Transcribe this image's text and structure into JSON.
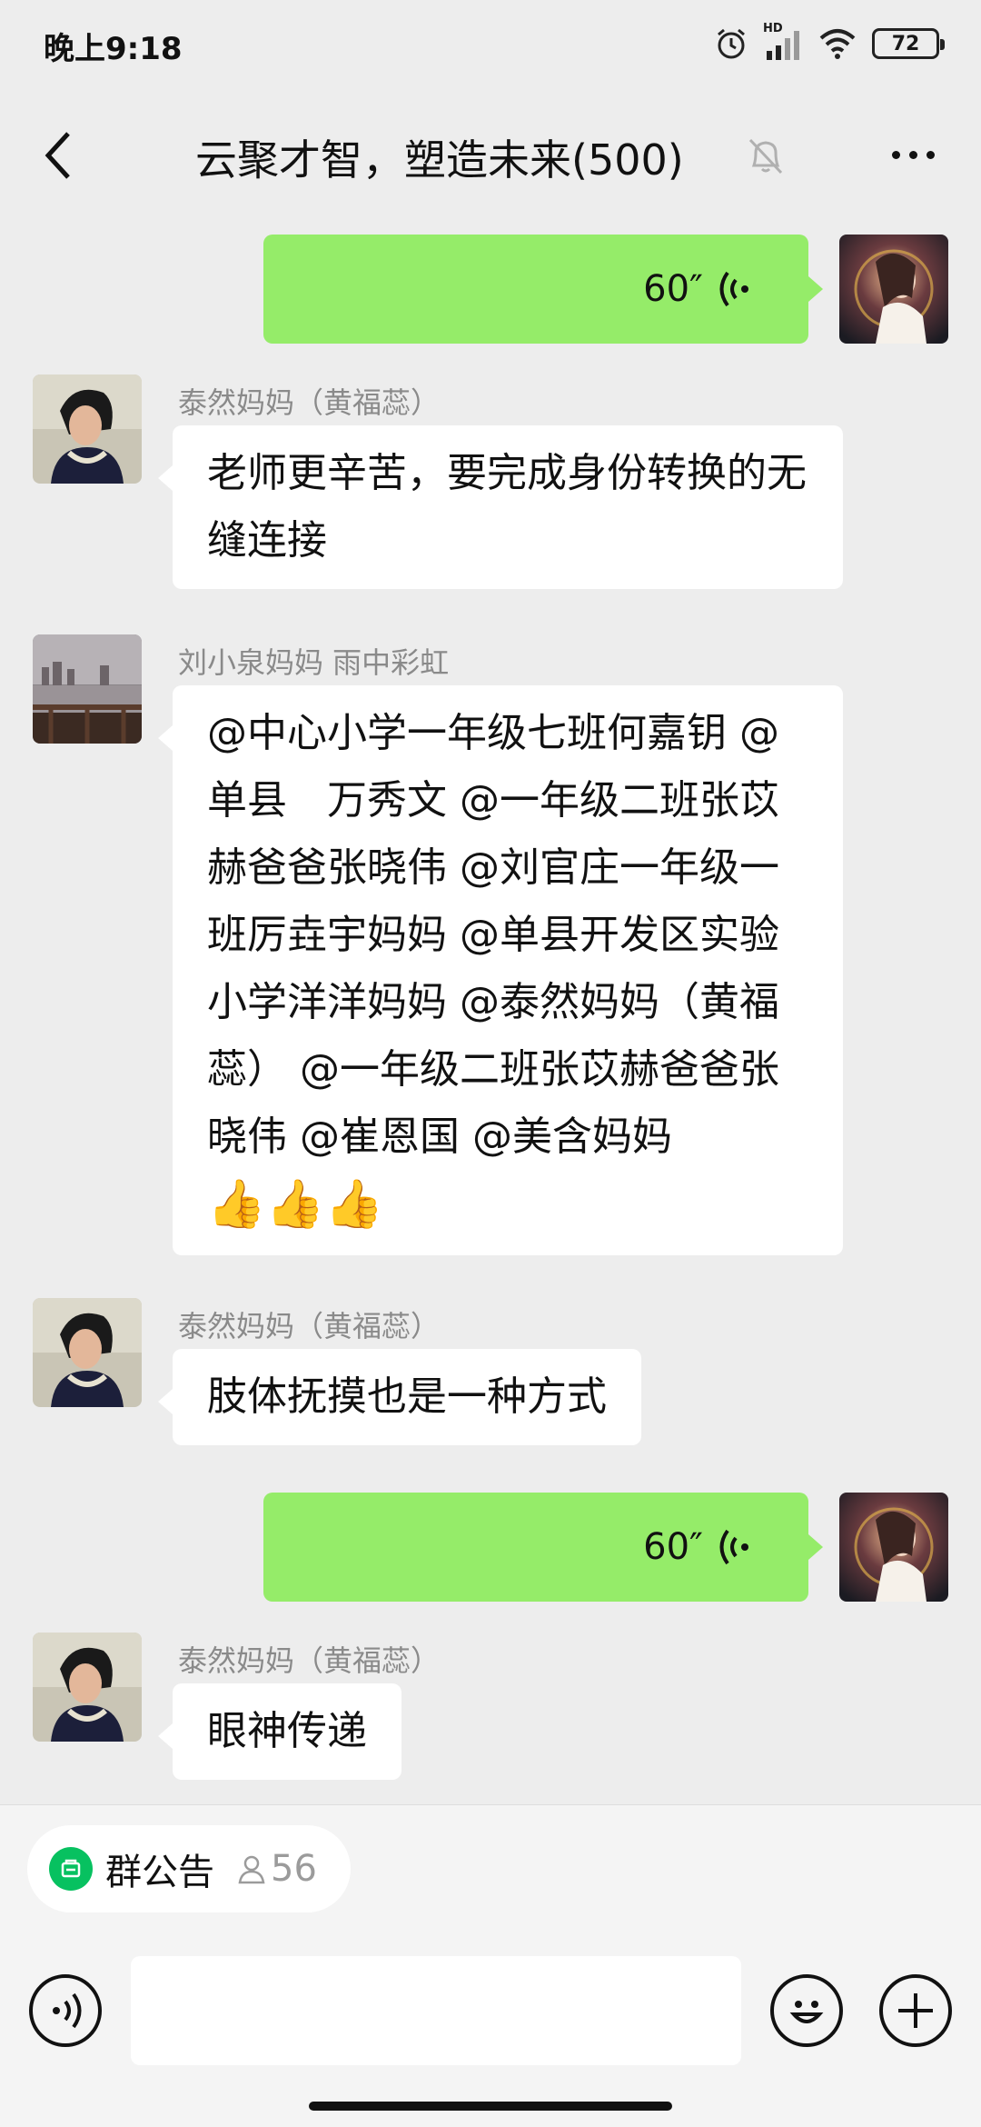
{
  "status_bar": {
    "time": "晚上9:18",
    "network_label": "HD",
    "battery": "72"
  },
  "header": {
    "title": "云聚才智，塑造未来(500)"
  },
  "messages": [
    {
      "type": "voice",
      "direction": "out",
      "duration": "60″"
    },
    {
      "type": "text",
      "direction": "in",
      "sender": "泰然妈妈（黄福蕊）",
      "text": "老师更辛苦，要完成身份转换的无缝连接"
    },
    {
      "type": "text",
      "direction": "in",
      "sender": "刘小泉妈妈  雨中彩虹",
      "text": "@中心小学一年级七班何嘉钥 @单县　万秀文 @一年级二班张苡赫爸爸张晓伟 @刘官庄一年级一班厉垚宇妈妈 @单县开发区实验小学洋洋妈妈 @泰然妈妈（黄福蕊） @一年级二班张苡赫爸爸张晓伟 @崔恩国 @美含妈妈",
      "emoji": "👍👍👍"
    },
    {
      "type": "text",
      "direction": "in",
      "sender": "泰然妈妈（黄福蕊）",
      "text": "肢体抚摸也是一种方式"
    },
    {
      "type": "voice",
      "direction": "out",
      "duration": "60″"
    },
    {
      "type": "text",
      "direction": "in",
      "sender": "泰然妈妈（黄福蕊）",
      "text": "眼神传递"
    }
  ],
  "notice": {
    "label": "群公告",
    "count": "56"
  },
  "colors": {
    "background": "#ededed",
    "out_bubble": "#95ec69",
    "in_bubble": "#ffffff",
    "notice_icon": "#07c160"
  }
}
